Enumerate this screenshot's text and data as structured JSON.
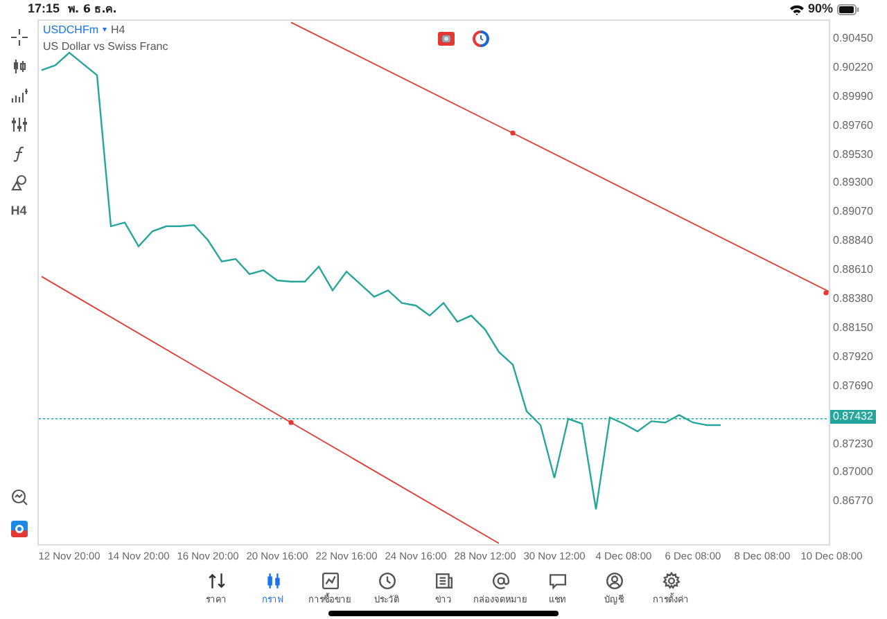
{
  "status_bar": {
    "time": "17:15",
    "date": "พ. 6 ธ.ค.",
    "battery": "90%"
  },
  "toolbar": {
    "timeframe": "H4"
  },
  "chart": {
    "symbol": "USDCHFm",
    "dropdown": "▾",
    "timeframe": "H4",
    "description": "US Dollar vs Swiss Franc",
    "current_price": "0.87432",
    "chart_data": {
      "type": "line",
      "ylim": [
        0.86433,
        0.90593
      ],
      "categories": [
        null,
        null,
        "12 Nov 20:00",
        null,
        null,
        null,
        null,
        "14 Nov 20:00",
        null,
        null,
        null,
        null,
        "16 Nov 20:00",
        null,
        null,
        null,
        null,
        "20 Nov 16:00",
        null,
        null,
        null,
        null,
        "22 Nov 16:00",
        null,
        null,
        null,
        null,
        "24 Nov 16:00",
        null,
        null,
        null,
        null,
        "28 Nov 12:00",
        null,
        null,
        null,
        null,
        "30 Nov 12:00",
        null,
        null,
        null,
        null,
        "4 Dec 08:00",
        null,
        null,
        null,
        null,
        "6 Dec 08:00",
        null,
        null,
        null,
        null,
        "8 Dec 08:00",
        null,
        null,
        null,
        null,
        "10 Dec 08:00"
      ],
      "series": [
        {
          "color": "#26a69a",
          "values": [
            0.902,
            0.9024,
            0.9034,
            0.9025,
            0.9016,
            0.8896,
            0.8899,
            0.888,
            0.8892,
            0.8896,
            0.8896,
            0.8897,
            0.8885,
            0.8868,
            0.887,
            0.8858,
            0.8861,
            0.8853,
            0.8852,
            0.8852,
            0.8864,
            0.8845,
            0.886,
            0.885,
            0.884,
            0.8845,
            0.8835,
            0.8833,
            0.8825,
            0.8835,
            0.882,
            0.8825,
            0.8814,
            0.8796,
            0.8786,
            0.8749,
            0.8738,
            0.8696,
            0.8743,
            0.8739,
            0.8671,
            0.8744,
            0.8739,
            0.8733,
            0.8741,
            0.874,
            0.8746,
            0.874,
            0.8738,
            0.8738,
            null,
            null,
            null,
            null,
            null,
            null,
            null,
            null
          ]
        },
        {
          "color": "#e53935",
          "values": [
            null,
            null,
            null,
            null,
            null,
            null,
            null,
            null,
            null,
            null,
            null,
            null,
            null,
            null,
            null,
            null,
            null,
            null,
            0.9058,
            null,
            null,
            null,
            null,
            null,
            null,
            null,
            null,
            null,
            null,
            null,
            null,
            null,
            null,
            null,
            0.897,
            null,
            null,
            null,
            null,
            null,
            null,
            null,
            null,
            null,
            null,
            null,
            null,
            null,
            null,
            null,
            null,
            null,
            null,
            null,
            null,
            null,
            null,
            0.8843
          ]
        },
        {
          "color": "#e53935",
          "values": [
            0.8856,
            null,
            null,
            null,
            null,
            null,
            null,
            null,
            null,
            null,
            null,
            null,
            null,
            null,
            null,
            null,
            null,
            null,
            0.874,
            null,
            null,
            null,
            null,
            null,
            null,
            null,
            null,
            null,
            null,
            null,
            null,
            null,
            null,
            0.8644,
            null,
            null,
            null,
            null,
            null,
            null,
            null,
            null,
            null,
            null,
            null,
            null,
            null,
            null,
            null,
            null,
            null,
            null,
            null,
            null,
            null,
            null,
            null,
            null
          ]
        }
      ],
      "ref_lines": [
        {
          "axis": "y",
          "value": 0.8743,
          "color": "#26a69a"
        }
      ],
      "yticks": [
        {
          "value": 0.9045,
          "label": "0.90450"
        },
        {
          "value": 0.9022,
          "label": "0.90220"
        },
        {
          "value": 0.8999,
          "label": "0.89990"
        },
        {
          "value": 0.8976,
          "label": "0.89760"
        },
        {
          "value": 0.8953,
          "label": "0.89530"
        },
        {
          "value": 0.893,
          "label": "0.89300"
        },
        {
          "value": 0.8907,
          "label": "0.89070"
        },
        {
          "value": 0.8884,
          "label": "0.88840"
        },
        {
          "value": 0.8861,
          "label": "0.88610"
        },
        {
          "value": 0.8838,
          "label": "0.88380"
        },
        {
          "value": 0.8815,
          "label": "0.88150"
        },
        {
          "value": 0.8792,
          "label": "0.87920"
        },
        {
          "value": 0.8769,
          "label": "0.87690"
        },
        {
          "value": 0.8723,
          "label": "0.87230"
        },
        {
          "value": 0.87,
          "label": "0.87000"
        },
        {
          "value": 0.8677,
          "label": "0.86770"
        }
      ]
    }
  },
  "tab_bar": [
    {
      "label": "ราคา",
      "kind": "quotes",
      "selected": false
    },
    {
      "label": "กราฟ",
      "kind": "chart",
      "selected": true
    },
    {
      "label": "การซื้อขาย",
      "kind": "trade",
      "selected": false
    },
    {
      "label": "ประวัติ",
      "kind": "history",
      "selected": false
    },
    {
      "label": "ข่าว",
      "kind": "news",
      "selected": false
    },
    {
      "label": "กล่องจดหมาย",
      "kind": "mail",
      "selected": false
    },
    {
      "label": "แชท",
      "kind": "chat",
      "selected": false
    },
    {
      "label": "บัญชี",
      "kind": "account",
      "selected": false
    },
    {
      "label": "การตั้งค่า",
      "kind": "settings",
      "selected": false
    }
  ]
}
